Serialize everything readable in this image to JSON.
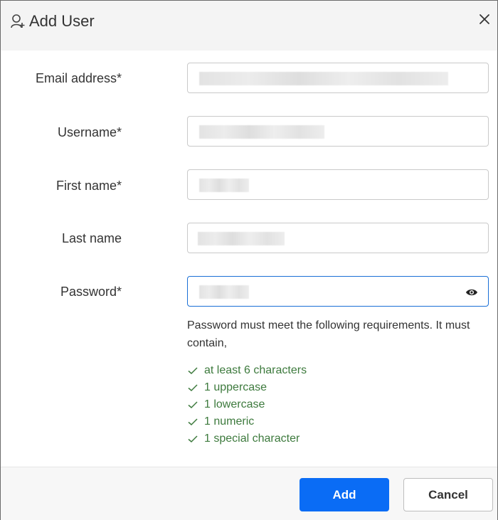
{
  "dialog": {
    "title": "Add User",
    "icon": "user-add-icon",
    "close_icon": "close-icon"
  },
  "form": {
    "email": {
      "label": "Email address*",
      "value": ""
    },
    "username": {
      "label": "Username*",
      "value": ""
    },
    "first_name": {
      "label": "First name*",
      "value": ""
    },
    "last_name": {
      "label": "Last name",
      "value": ""
    },
    "password": {
      "label": "Password*",
      "value": "",
      "toggle_icon": "eye-icon"
    }
  },
  "requirements": {
    "intro": "Password must meet the following requirements. It must contain,",
    "items": [
      "at least 6 characters",
      "1 uppercase",
      "1 lowercase",
      "1 numeric",
      "1 special character"
    ],
    "met_color": "#3d7a3d"
  },
  "footer": {
    "add_label": "Add",
    "cancel_label": "Cancel"
  },
  "colors": {
    "primary": "#0a6cf5",
    "focus_border": "#1a6fd6",
    "header_bg": "#f4f4f4"
  }
}
